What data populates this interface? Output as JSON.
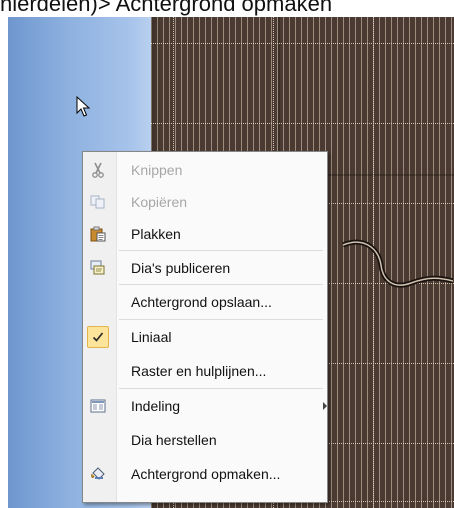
{
  "caption": "hierdelen)> Achtergrond opmaken",
  "icons": {
    "cursor": "mouse-pointer-icon",
    "cut": "scissors-icon",
    "copy": "copy-icon",
    "paste": "clipboard-icon",
    "publish": "publish-slides-icon",
    "check": "checkmark-icon",
    "layout": "layout-icon",
    "format_background": "paint-bucket-icon",
    "submenu": "submenu-arrow-icon"
  },
  "menu": {
    "items": [
      {
        "label": "Knippen",
        "disabled": true
      },
      {
        "label": "Kopiëren",
        "disabled": true
      },
      {
        "label": "Plakken"
      },
      {
        "label": "Dia's publiceren"
      },
      {
        "label": "Achtergrond opslaan..."
      },
      {
        "label": "Liniaal",
        "checked": true
      },
      {
        "label": "Raster en hulplijnen..."
      },
      {
        "label": "Indeling",
        "submenu": true
      },
      {
        "label": "Dia herstellen"
      },
      {
        "label": "Achtergrond opmaken..."
      }
    ]
  },
  "colors": {
    "slide_background": "#4a3a31",
    "left_pane": "#8fb2e0",
    "menu_background": "#fafafa",
    "checked_highlight": "#fde49b"
  }
}
